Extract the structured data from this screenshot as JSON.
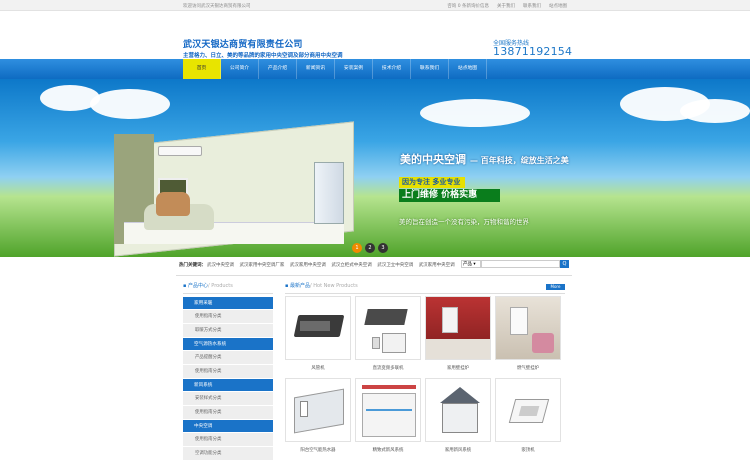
{
  "topbar": {
    "welcome": "欢迎访问武汉天银达商贸有限公司",
    "links": [
      "咨询 0 条新询价信息",
      "关于我们",
      "联系我们",
      "站点地图"
    ]
  },
  "header": {
    "company": "武汉天银达商贸有限责任公司",
    "slogan": "主营格力、日立、美的等品牌的家用中央空调及部分商用中央空调",
    "hotline_label": "全国服务热线",
    "hotline": "13871192154"
  },
  "nav": {
    "items": [
      "首页",
      "公司简介",
      "产品介绍",
      "新闻资讯",
      "安装案例",
      "技术介绍",
      "联系我们",
      "站点地图"
    ]
  },
  "banner": {
    "title": "美的中央空调",
    "subtitle": "— 百年科技，绽放生活之美",
    "box1": "因为专注 多业专业",
    "box2": "上门维修  价格实惠",
    "tagline": "美的旨在创造一个没有污染，万物和谐的世界",
    "pages": [
      "1",
      "2",
      "3"
    ]
  },
  "hot": {
    "title": "热门关键词：",
    "words": [
      "武汉中央空调",
      "武汉家用中央空调厂家",
      "武汉家用中央空调",
      "武汉立柜式中央空调",
      "武汉卫立中央空调",
      "武汉家用中央空调"
    ],
    "select_label": "产品",
    "search_btn": "Q"
  },
  "sidebar": {
    "title": "产品中心",
    "title_en": "/ Products",
    "groups": [
      {
        "cat": "家用采暖",
        "subs": [
          "使用指南分类",
          "取暖方式分类"
        ]
      },
      {
        "cat": "空气源热水系统",
        "subs": [
          "产品提醒分类",
          "使用指南分类"
        ]
      },
      {
        "cat": "新风系统",
        "subs": [
          "安装样式分类",
          "使用指南分类"
        ]
      },
      {
        "cat": "中央空调",
        "subs": [
          "使用指南分类",
          "空调功能分类"
        ]
      }
    ]
  },
  "products": {
    "title": "最新产品",
    "title_en": "/ Hot New Products",
    "more": "More",
    "items": [
      "风管机",
      "直流变频多联机",
      "家用壁挂炉",
      "燃气壁挂炉",
      "阳台空气能热水器",
      "精致式新风系统",
      "家用新风系统",
      "嵌顶机"
    ]
  }
}
